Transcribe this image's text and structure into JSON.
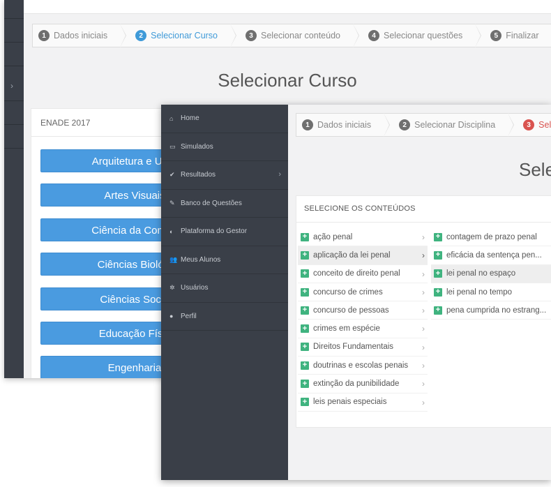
{
  "back": {
    "wizard": [
      {
        "num": "1",
        "label": "Dados iniciais",
        "state": "done"
      },
      {
        "num": "2",
        "label": "Selecionar Curso",
        "state": "active"
      },
      {
        "num": "3",
        "label": "Selecionar conteúdo",
        "state": "todo"
      },
      {
        "num": "4",
        "label": "Selecionar questões",
        "state": "todo"
      },
      {
        "num": "5",
        "label": "Finalizar",
        "state": "todo"
      }
    ],
    "title": "Selecionar Curso",
    "panel_title": "ENADE 2017",
    "courses": [
      "Arquitetura e Urba",
      "Artes Visuais",
      "Ciência da Compu",
      "Ciências Biológi",
      "Ciências Socia",
      "Educação Físic",
      "Engenharia"
    ]
  },
  "front": {
    "nav": [
      {
        "icon": "home-icon",
        "glyph": "⌂",
        "label": "Home"
      },
      {
        "icon": "laptop-icon",
        "glyph": "▭",
        "label": "Simulados"
      },
      {
        "icon": "check-icon",
        "glyph": "✔",
        "label": "Resultados",
        "arrow": "›"
      },
      {
        "icon": "edit-icon",
        "glyph": "✎",
        "label": "Banco de Questões"
      },
      {
        "icon": "dashboard-icon",
        "glyph": "◐",
        "label": "Plataforma do Gestor"
      },
      {
        "icon": "users-icon",
        "glyph": "👥",
        "label": "Meus Alunos"
      },
      {
        "icon": "gear-icon",
        "glyph": "✲",
        "label": "Usuários"
      },
      {
        "icon": "user-icon",
        "glyph": "●",
        "label": "Perfil"
      }
    ],
    "wizard": [
      {
        "num": "1",
        "label": "Dados iniciais",
        "state": "done"
      },
      {
        "num": "2",
        "label": "Selecionar Disciplina",
        "state": "done"
      },
      {
        "num": "3",
        "label": "Selecionar conteúdo",
        "state": "active"
      }
    ],
    "title": "Sele",
    "panel_title": "SELECIONE OS CONTEÚDOS",
    "topics": [
      {
        "label": "ação penal",
        "selected": false
      },
      {
        "label": "aplicação da lei penal",
        "selected": true
      },
      {
        "label": "conceito de direito penal",
        "selected": false
      },
      {
        "label": "concurso de crimes",
        "selected": false
      },
      {
        "label": "concurso de pessoas",
        "selected": false
      },
      {
        "label": "crimes em espécie",
        "selected": false
      },
      {
        "label": "Direitos Fundamentais",
        "selected": false
      },
      {
        "label": "doutrinas e escolas penais",
        "selected": false
      },
      {
        "label": "extinção da punibilidade",
        "selected": false
      },
      {
        "label": "leis penais especiais",
        "selected": false
      }
    ],
    "subtopics": [
      {
        "label": "contagem de prazo penal",
        "selected": false
      },
      {
        "label": "eficácia da sentença pen...",
        "selected": false
      },
      {
        "label": "lei penal no espaço",
        "selected": true
      },
      {
        "label": "lei penal no tempo",
        "selected": false
      },
      {
        "label": "pena cumprida no estrang...",
        "selected": false
      }
    ],
    "add_glyph": "+",
    "expand_glyph": "›"
  }
}
